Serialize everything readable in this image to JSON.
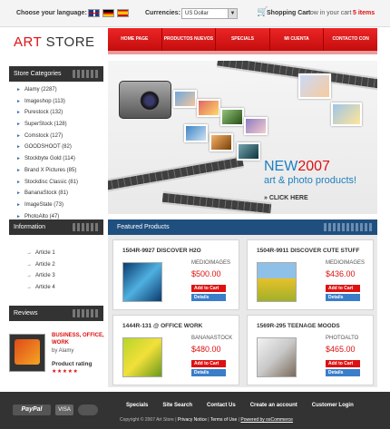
{
  "topbar": {
    "language_label": "Choose your language:",
    "currencies_label": "Currencies:",
    "currency_selected": "US Dollar",
    "cart_label": "Shopping Cart",
    "cart_now": "now in your cart",
    "cart_items": "5 items"
  },
  "logo": {
    "part1": "ART",
    "part2": "STORE"
  },
  "nav": [
    "HOME PAGE",
    "PRODUCTOS NUEVOS",
    "SPECIALS",
    "MI CUENTA",
    "CONTACTO CON"
  ],
  "sidebar": {
    "categories_title": "Store Categories",
    "categories": [
      "Alamy (2287)",
      "Imageshop (113)",
      "Purestock (132)",
      "SuperStock (128)",
      "Comstock (127)",
      "GOODSHOOT (82)",
      "Stockbyte Gold (114)",
      "Brand X Pictures (85)",
      "Stockdisc Classic (81)",
      "BananaStock (81)",
      "ImageState (73)",
      "PhotoAlto (47)"
    ],
    "information_title": "Information",
    "articles": [
      "Article 1",
      "Article 2",
      "Article 3",
      "Article 4"
    ],
    "reviews_title": "Reviews",
    "review": {
      "title": "BUSINESS, OFFICE, WORK",
      "by": "by Alamy",
      "rating_label": "Product rating",
      "stars": "★★★★★",
      "rating": 5
    }
  },
  "banner": {
    "new": "NEW",
    "year": "2007",
    "subtitle": "art & photo products!",
    "click_here": "» CLICK HERE"
  },
  "featured": {
    "title": "Featured Products",
    "products": [
      {
        "title": "1504R-9927 DISCOVER H2O",
        "brand": "MEDIOIMAGES",
        "price": "$500.00"
      },
      {
        "title": "1504R-9911 DISCOVER CUTE STUFF",
        "brand": "MEDIOIMAGES",
        "price": "$436.00"
      },
      {
        "title": "1444R-131 @ OFFICE WORK",
        "brand": "BANANASTOCK",
        "price": "$480.00"
      },
      {
        "title": "1569R-295 TEENAGE MOODS",
        "brand": "PHOTOALTO",
        "price": "$465.00"
      }
    ],
    "add_to_cart": "Add to Cart",
    "details": "Details"
  },
  "footer": {
    "links": [
      "Specials",
      "Site Search",
      "Contact Us",
      "Create an account",
      "Customer Login"
    ],
    "copyright": "Copyright © 2007 Art Store",
    "privacy": "Privacy Notice",
    "terms": "Terms of Use",
    "powered": "Powered by osCommerce",
    "payments": [
      "PayPal",
      "VISA",
      "MasterCard"
    ]
  },
  "colors": {
    "accent": "#d11111",
    "nav": "#e01b1b",
    "featured_header": "#1f4f7f",
    "footer": "#333333"
  }
}
